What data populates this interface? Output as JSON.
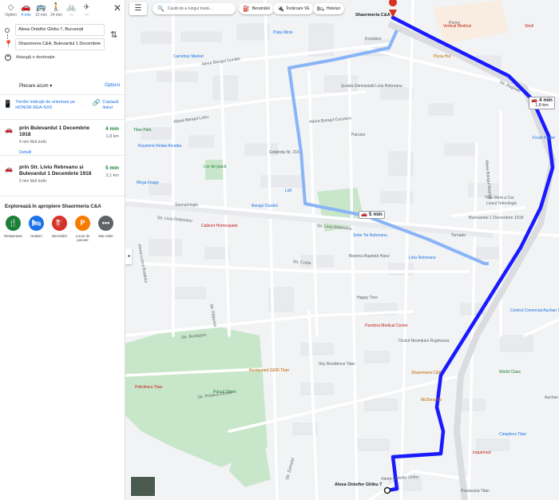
{
  "panel": {
    "modes": [
      {
        "label": "Optimi",
        "icon": "directions-diamond-icon",
        "glyph": "◇",
        "active": false
      },
      {
        "label": "4 min",
        "icon": "car-icon",
        "glyph": "🚗",
        "active": true
      },
      {
        "label": "12 min",
        "icon": "transit-icon",
        "glyph": "🚌",
        "active": false
      },
      {
        "label": "24 min",
        "icon": "walk-icon",
        "glyph": "🚶",
        "active": false
      },
      {
        "label": "—",
        "icon": "bike-icon",
        "glyph": "🚲",
        "active": false
      },
      {
        "label": "—",
        "icon": "flight-icon",
        "glyph": "✈",
        "active": false
      }
    ],
    "close_glyph": "✕",
    "origin": "Aleea Onisifor Ghibu 7, București",
    "destination": "Shaormeria C&A, Bulevardul 1 Decembrie",
    "add_destination": "Adaugă o destinație",
    "depart_label": "Plecare acum ▾",
    "options_label": "Opțiuni",
    "send_text": "Trimite indicații de orientare pe HONOR REA-NX9",
    "copy_text": "Copiază linkul",
    "routes": [
      {
        "name": "prin Bulevardul 1 Decembrie 1918",
        "duration": "4 min",
        "distance": "1,8 km",
        "traffic": "4 min fără trafic",
        "details": "Detalii"
      },
      {
        "name": "prin Str. Liviu Rebreanu și Bulevardul 1 Decembrie 1918",
        "duration": "5 min",
        "distance": "2,1 km",
        "traffic": "5 min fără trafic"
      }
    ],
    "explore_title": "Explorează în apropiere Shaormeria C&A",
    "categories": [
      {
        "label": "Restaurante",
        "icon": "restaurant-icon",
        "glyph": "🍴",
        "color": "#188038"
      },
      {
        "label": "Hoteluri",
        "icon": "hotel-icon",
        "glyph": "🛏",
        "color": "#1a73e8"
      },
      {
        "label": "Benzinării",
        "icon": "gas-station-icon",
        "glyph": "⛽",
        "color": "#d93025"
      },
      {
        "label": "Locuri de parcare",
        "icon": "parking-icon",
        "glyph": "P",
        "color": "#f57c00"
      },
      {
        "label": "Mai multe",
        "icon": "more-icon",
        "glyph": "•••",
        "color": "#5f6368"
      }
    ]
  },
  "map": {
    "search_placeholder": "Caută de-a lungul trasă...",
    "chips": [
      {
        "label": "Benzinării",
        "icon": "gas-chip-icon",
        "glyph": "⛽"
      },
      {
        "label": "Încărcare VE",
        "icon": "ev-charge-icon",
        "glyph": "🔌"
      },
      {
        "label": "Hoteluri",
        "icon": "hotel-chip-icon",
        "glyph": "🛏"
      }
    ],
    "route_badges": [
      {
        "duration": "4 min",
        "distance": "1,8 km"
      },
      {
        "duration": "5 min",
        "distance": "2,1 km"
      }
    ],
    "colors": {
      "primary_route": "#1a1aff",
      "alt_route": "#8ab4f8",
      "park": "#c8e6c9",
      "road": "#ffffff",
      "block": "#e8eaed"
    },
    "destination_label": "Shaormeria C&A",
    "origin_label": "Aleea Onisifor Ghibu 7",
    "streets": [
      "Aleea Barajul Dunării",
      "Aleea Barajul Lotru",
      "Str. Liviu Rebreanu",
      "Str. Liviu Rebreanu",
      "Aleea Barajul Cucuteni",
      "Aleea Barajul Bistriței",
      "Str. Codia",
      "Str. Burdujeni",
      "Str. Prisaca Dornei",
      "Aleea Onisifor Ghibu",
      "Str. Rașinari",
      "Aleea Lunca Bradului",
      "Str. Zizinului",
      "Str. Pădurea",
      "Bulevardul 1 Decembrie 1918"
    ],
    "pois": [
      {
        "label": "Penny",
        "kind": "poi"
      },
      {
        "label": "Piața Minis",
        "kind": "blue"
      },
      {
        "label": "Evolution",
        "kind": "poi"
      },
      {
        "label": "Carrefour Market",
        "kind": "blue"
      },
      {
        "label": "Școala Gimnazială Liviu Rebreanu",
        "kind": "poi"
      },
      {
        "label": "Vertical Medical",
        "kind": "red"
      },
      {
        "label": "Pizza Hut",
        "kind": "orange"
      },
      {
        "label": "Titan Park",
        "kind": "green"
      },
      {
        "label": "Keystone Relais Arcadia",
        "kind": "blue"
      },
      {
        "label": "Grădinița Nr. 216",
        "kind": "poi"
      },
      {
        "label": "Loc de joacă",
        "kind": "green"
      },
      {
        "label": "Mega Image",
        "kind": "blue"
      },
      {
        "label": "Lidl",
        "kind": "blue"
      },
      {
        "label": "Parcare",
        "kind": "poi"
      },
      {
        "label": "Stomatologie",
        "kind": "poi"
      },
      {
        "label": "Barajul Dunării",
        "kind": "blue"
      },
      {
        "label": "Cabinet Homeopatie",
        "kind": "red"
      },
      {
        "label": "Sebe Tei Rebreanu",
        "kind": "blue"
      },
      {
        "label": "Biserica Baptistă Harul",
        "kind": "poi"
      },
      {
        "label": "Liviu Rebreanu",
        "kind": "blue"
      },
      {
        "label": "Happy Tree",
        "kind": "poi"
      },
      {
        "label": "Pandora Medical Center",
        "kind": "red"
      },
      {
        "label": "Ocolul Neamțului Ruginoasa",
        "kind": "poi"
      },
      {
        "label": "Restaurant GEBI Titan",
        "kind": "orange"
      },
      {
        "label": "Parcul Titanii",
        "kind": "green"
      },
      {
        "label": "Policlinica Titan",
        "kind": "red"
      },
      {
        "label": "Sky Residence Titan",
        "kind": "poi"
      },
      {
        "label": "Shaormeria C&A",
        "kind": "orange"
      },
      {
        "label": "McDonald's",
        "kind": "orange"
      },
      {
        "label": "World Class",
        "kind": "green"
      },
      {
        "label": "Cineplexx Titan",
        "kind": "blue"
      },
      {
        "label": "Imparmed",
        "kind": "red"
      },
      {
        "label": "Postavaria Titan",
        "kind": "poi"
      },
      {
        "label": "Shell",
        "kind": "red"
      },
      {
        "label": "Fourli Pastel",
        "kind": "blue"
      },
      {
        "label": "Auchan",
        "kind": "poi"
      },
      {
        "label": "Centrul Comercial Auchan Titan",
        "kind": "blue"
      },
      {
        "label": "Tornado",
        "kind": "poi"
      },
      {
        "label": "Liceul Tehnologic",
        "kind": "poi"
      },
      {
        "label": "Titan Rent a Car",
        "kind": "poi"
      }
    ]
  }
}
